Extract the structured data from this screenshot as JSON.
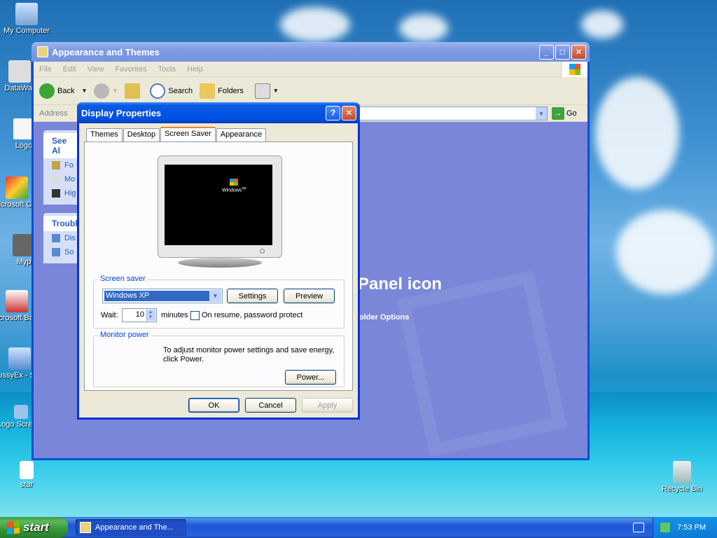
{
  "desktop": {
    "icons": [
      {
        "label": "My Computer"
      },
      {
        "label": "DataWar"
      },
      {
        "label": "Logo"
      },
      {
        "label": "Microsoft C++"
      },
      {
        "label": "Myp"
      },
      {
        "label": "Microsoft Basic"
      },
      {
        "label": "SussyEx - Shor"
      },
      {
        "label": "Logo Screens"
      },
      {
        "label": "star"
      },
      {
        "label": "Recycle Bin"
      }
    ]
  },
  "explorer": {
    "title": "Appearance and Themes",
    "menu": [
      "File",
      "Edit",
      "View",
      "Favorites",
      "Tools",
      "Help"
    ],
    "toolbar": {
      "back": "Back",
      "search": "Search",
      "folders": "Folders"
    },
    "address_label": "Address",
    "go_label": "Go",
    "see_also_header": "See Al",
    "see_also_items": [
      "Fo",
      "Mo",
      "Hig"
    ],
    "troubleshoot_header": "Troubl",
    "troubleshoot_items": [
      "Dis",
      "So"
    ],
    "panel_heading": "Panel icon",
    "panel_link": "older Options"
  },
  "dialog": {
    "title": "Display Properties",
    "tabs": [
      "Themes",
      "Desktop",
      "Screen Saver",
      "Appearance"
    ],
    "active_tab": "Screen Saver",
    "preview_logo": "Windows",
    "preview_logo_sup": "xp",
    "screen_saver": {
      "group_label": "Screen saver",
      "selected": "Windows XP",
      "settings_label": "Settings",
      "preview_label": "Preview",
      "wait_label": "Wait:",
      "wait_value": "10",
      "minutes_label": "minutes",
      "password_label": "On resume, password protect",
      "password_checked": false
    },
    "monitor_power": {
      "group_label": "Monitor power",
      "text": "To adjust monitor power settings and save energy, click Power.",
      "power_label": "Power..."
    },
    "buttons": {
      "ok": "OK",
      "cancel": "Cancel",
      "apply": "Apply"
    }
  },
  "taskbar": {
    "start_label": "start",
    "task_item": "Appearance and The...",
    "clock": "7:53 PM"
  }
}
